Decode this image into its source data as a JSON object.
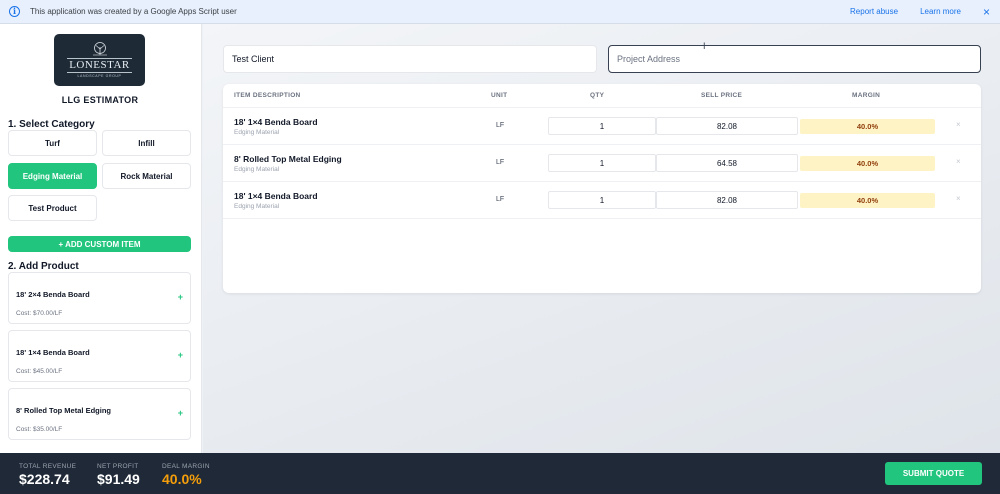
{
  "banner": {
    "message": "This application was created by a Google Apps Script user",
    "report_abuse": "Report abuse",
    "learn_more": "Learn more",
    "close": "×",
    "info_glyph": "i"
  },
  "sidebar": {
    "logo": {
      "wordmark": "LONESTAR",
      "tagline": "LANDSCAPE GROUP"
    },
    "app_title": "LLG ESTIMATOR",
    "select_category_title": "1. Select Category",
    "categories": [
      {
        "label": "Turf",
        "active": false
      },
      {
        "label": "Infill",
        "active": false
      },
      {
        "label": "Edging Material",
        "active": true
      },
      {
        "label": "Rock Material",
        "active": false
      },
      {
        "label": "Test Product",
        "active": false
      }
    ],
    "add_custom_label": "+ ADD CUSTOM ITEM",
    "add_product_title": "2. Add Product",
    "products": [
      {
        "name": "18' 2×4 Benda Board",
        "cost": "Cost: $70.00/LF",
        "add": "+"
      },
      {
        "name": "18' 1×4 Benda Board",
        "cost": "Cost: $45.00/LF",
        "add": "+"
      },
      {
        "name": "8' Rolled Top Metal Edging",
        "cost": "Cost: $35.00/LF",
        "add": "+"
      }
    ]
  },
  "main": {
    "client_value": "Test Client",
    "address_placeholder": "Project Address",
    "table": {
      "headers": {
        "description": "ITEM DESCRIPTION",
        "unit": "UNIT",
        "qty": "QTY",
        "sell_price": "SELL PRICE",
        "margin": "MARGIN"
      },
      "rows": [
        {
          "name": "18' 1×4 Benda Board",
          "category": "Edging Material",
          "unit": "LF",
          "qty": "1",
          "price": "82.08",
          "margin": "40.0%",
          "remove": "×"
        },
        {
          "name": "8' Rolled Top Metal Edging",
          "category": "Edging Material",
          "unit": "LF",
          "qty": "1",
          "price": "64.58",
          "margin": "40.0%",
          "remove": "×"
        },
        {
          "name": "18' 1×4 Benda Board",
          "category": "Edging Material",
          "unit": "LF",
          "qty": "1",
          "price": "82.08",
          "margin": "40.0%",
          "remove": "×"
        }
      ]
    }
  },
  "footer": {
    "total_revenue_label": "TOTAL REVENUE",
    "total_revenue_value": "$228.74",
    "net_profit_label": "NET PROFIT",
    "net_profit_value": "$91.49",
    "deal_margin_label": "DEAL MARGIN",
    "deal_margin_value": "40.0%",
    "submit_label": "SUBMIT QUOTE"
  },
  "colors": {
    "accent_green": "#22c57e",
    "footer_bg": "#1f2937",
    "margin_highlight": "#fdf3c4",
    "deal_margin_orange": "#f59e0b",
    "link_blue": "#1a73e8"
  }
}
